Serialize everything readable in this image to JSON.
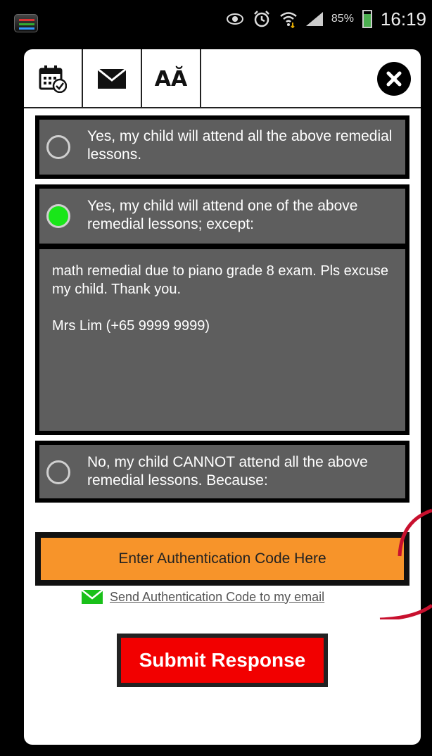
{
  "status_bar": {
    "battery_percent": "85%",
    "time": "16:19",
    "icons": [
      "app-launcher-icon",
      "eye-icon",
      "alarm-icon",
      "wifi-icon",
      "signal-icon",
      "battery-icon"
    ]
  },
  "toolbar": {
    "calendar_icon": "calendar-check-icon",
    "mail_icon": "envelope-icon",
    "font_size_label": "AĂ",
    "close_icon": "close-icon"
  },
  "options": [
    {
      "label": "Yes, my child will attend all the above remedial lessons.",
      "selected": false
    },
    {
      "label": "Yes, my child will attend one of the above remedial lessons; except:",
      "selected": true,
      "reason": "math remedial due to piano grade 8 exam. Pls excuse my child. Thank you.\n\nMrs Lim (+65 9999 9999)"
    },
    {
      "label": "No, my child CANNOT attend all the above remedial lessons. Because:",
      "selected": false
    }
  ],
  "auth": {
    "placeholder": "Enter Authentication Code Here",
    "email_link": "Send Authentication Code to my email",
    "email_icon": "mail-icon"
  },
  "submit_label": "Submit Response",
  "colors": {
    "option_bg": "#5e5e5e",
    "radio_selected": "#19e619",
    "auth_bg": "#f7942a",
    "submit_bg": "#f20000",
    "email_icon": "#19c019"
  }
}
